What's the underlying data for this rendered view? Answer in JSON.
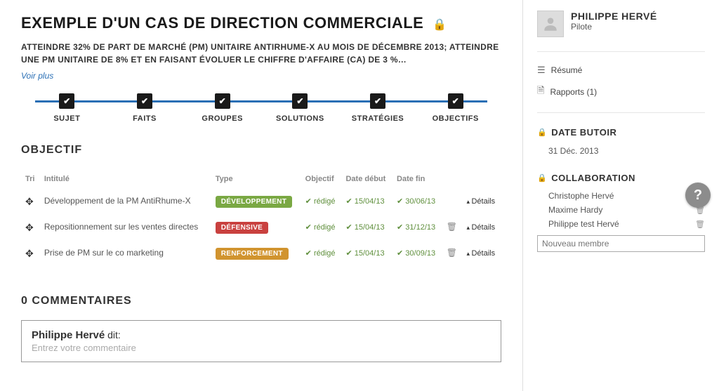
{
  "header": {
    "title": "EXEMPLE D'UN CAS DE DIRECTION COMMERCIALE",
    "subtitle": "ATTEINDRE 32% DE PART DE MARCHÉ (PM) UNITAIRE ANTIRHUME-X AU MOIS DE DÉCEMBRE 2013; ATTEINDRE UNE PM UNITAIRE DE 8% ET EN FAISANT ÉVOLUER LE CHIFFRE D'AFFAIRE (CA) DE 3 %…",
    "see_more": "Voir plus"
  },
  "steps": [
    {
      "label": "SUJET"
    },
    {
      "label": "FAITS"
    },
    {
      "label": "GROUPES"
    },
    {
      "label": "SOLUTIONS"
    },
    {
      "label": "STRATÉGIES"
    },
    {
      "label": "OBJECTIFS"
    }
  ],
  "objectif": {
    "heading": "OBJECTIF",
    "columns": {
      "tri": "Tri",
      "intitule": "Intitulé",
      "type": "Type",
      "objectif": "Objectif",
      "debut": "Date début",
      "fin": "Date fin"
    },
    "rows": [
      {
        "intitule": "Développement de la PM AntiRhume-X",
        "type": "DÉVELOPPEMENT",
        "type_class": "badge-dev",
        "objectif": "rédigé",
        "debut": "15/04/13",
        "fin": "30/06/13",
        "details": "Détails"
      },
      {
        "intitule": "Repositionnement sur les ventes directes",
        "type": "DÉFENSIVE",
        "type_class": "badge-def",
        "objectif": "rédigé",
        "debut": "15/04/13",
        "fin": "31/12/13",
        "details": "Détails"
      },
      {
        "intitule": "Prise de PM sur le co marketing",
        "type": "RENFORCEMENT",
        "type_class": "badge-ren",
        "objectif": "rédigé",
        "debut": "15/04/13",
        "fin": "30/09/13",
        "details": "Détails"
      }
    ]
  },
  "comments": {
    "heading": "0 COMMENTAIRES",
    "author": "Philippe Hervé",
    "says": " dit:",
    "placeholder": "Entrez votre commentaire"
  },
  "sidebar": {
    "profile": {
      "name": "PHILIPPE HERVÉ",
      "role": "Pilote"
    },
    "links": {
      "resume": "Résumé",
      "rapports": "Rapports (1)"
    },
    "deadline": {
      "heading": "DATE BUTOIR",
      "value": "31 Déc. 2013"
    },
    "collab": {
      "heading": "COLLABORATION",
      "members": [
        {
          "name": "Christophe Hervé"
        },
        {
          "name": "Maxime Hardy"
        },
        {
          "name": "Philippe test Hervé"
        }
      ],
      "new_placeholder": "Nouveau membre"
    }
  }
}
